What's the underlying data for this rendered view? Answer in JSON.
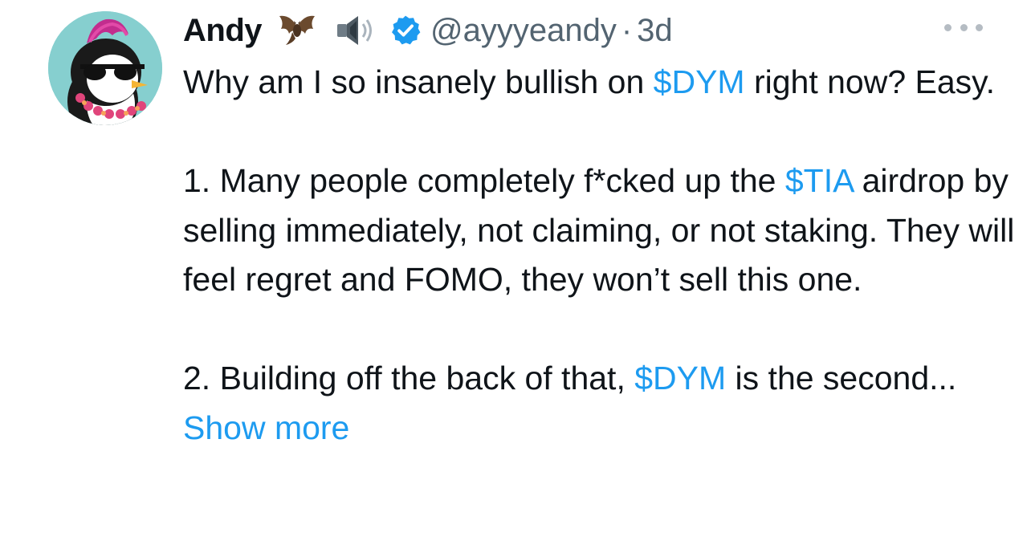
{
  "tweet": {
    "author_name": "Andy",
    "author_emojis": [
      "bat-emoji",
      "speaker-emoji"
    ],
    "verified": true,
    "handle": "@ayyyeandy",
    "separator": "·",
    "time": "3d",
    "paragraph1": {
      "pre": "Why am I so insanely bullish on ",
      "cashtag": "$DYM",
      "post": " right now? Easy."
    },
    "paragraph2": {
      "pre": "1. Many people completely f*cked up the ",
      "cashtag": "$TIA",
      "post": " airdrop by selling immediately, not claiming, or not staking. They will feel regret and FOMO, they won’t sell this one."
    },
    "paragraph3": {
      "pre": "2. Building off the back of that, ",
      "cashtag": "$DYM",
      "post": " is the second... ",
      "show_more": "Show more"
    },
    "colors": {
      "link": "#1d9bf0",
      "text": "#0f1419",
      "secondary": "#536471",
      "verified": "#1d9bf0",
      "avatar_bg": "#86cfcf"
    }
  }
}
